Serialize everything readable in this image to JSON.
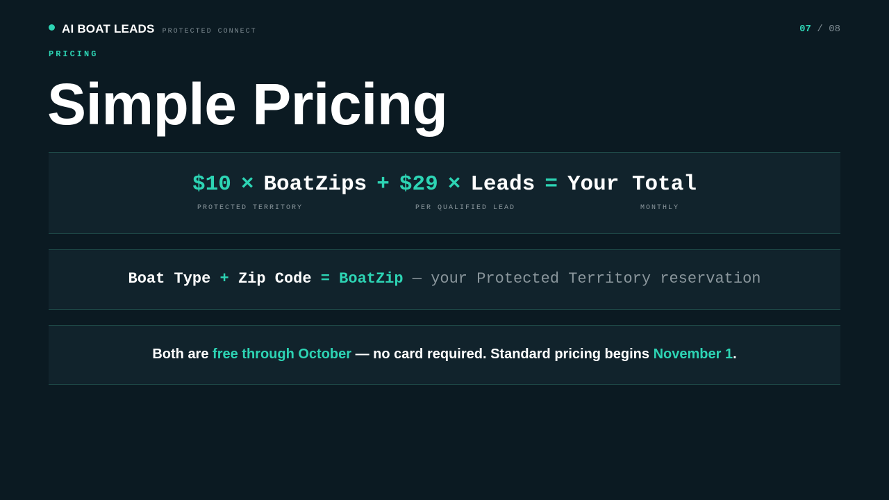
{
  "brand": {
    "name": "AI BOAT LEADS",
    "tagline": "PROTECTED CONNECT"
  },
  "pager": {
    "current": "07",
    "separator": "/",
    "total": "08"
  },
  "eyebrow": "PRICING",
  "title": "Simple Pricing",
  "formula": {
    "price1": "$10",
    "times1": "×",
    "unit1": "BoatZips",
    "plus": "+",
    "price2": "$29",
    "times2": "×",
    "unit2": "Leads",
    "equals": "=",
    "result": "Your Total",
    "captions": [
      "PROTECTED TERRITORY",
      "PER QUALIFIED LEAD",
      "MONTHLY"
    ]
  },
  "definition": {
    "part1": "Boat Type",
    "plus": "+",
    "part2": "Zip Code",
    "equals": "=",
    "term": "BoatZip",
    "explanation": "— your Protected Territory reservation"
  },
  "note": {
    "lead": "Both are",
    "highlight1": "free through October",
    "middle": "— no card required. Standard pricing begins",
    "highlight2": "November 1",
    "end": "."
  },
  "colors": {
    "background": "#0b1a22",
    "panel": "#11232c",
    "accent": "#2dd4b4",
    "muted": "#8a969c"
  }
}
